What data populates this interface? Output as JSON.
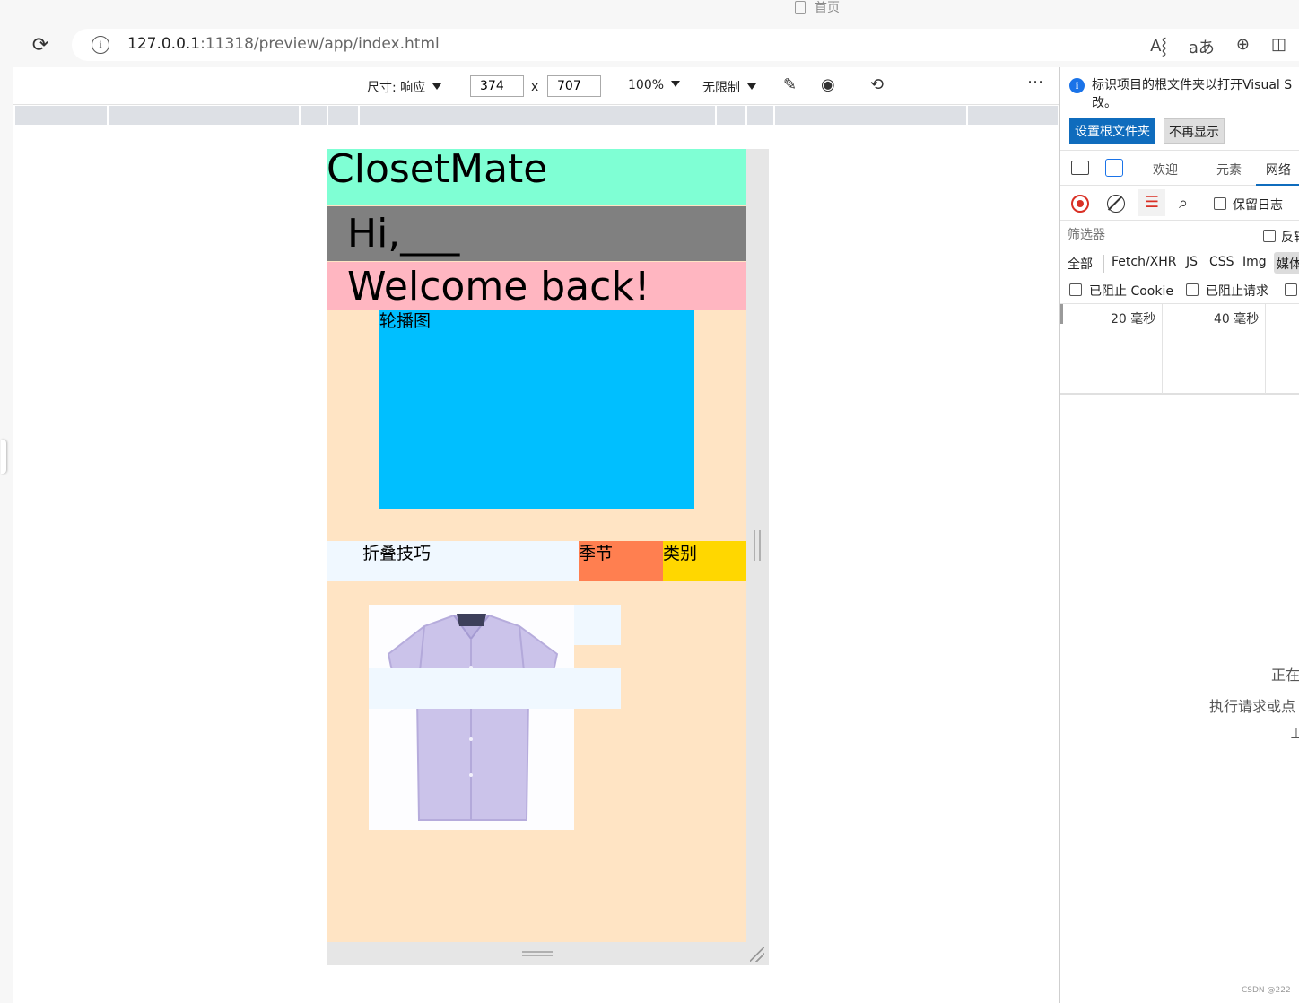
{
  "browser": {
    "tab_title": "首页",
    "url_host": "127.0.0.1",
    "url_rest": ":11318/preview/app/index.html",
    "icons": [
      "reload-icon",
      "info-icon",
      "read-aloud-icon",
      "translate-icon",
      "zoom-icon",
      "split-screen-icon"
    ],
    "read_aloud_glyph": "A⸾",
    "translate_glyph": "aあ"
  },
  "device_toolbar": {
    "size_label": "尺寸: 响应",
    "width": "374",
    "times": "x",
    "height": "707",
    "zoom": "100%",
    "throttle": "无限制",
    "more": "⋯"
  },
  "app": {
    "title": "ClosetMate",
    "greeting": "Hi,___",
    "welcome": "Welcome back!",
    "carousel_label": "轮播图",
    "tabs": [
      {
        "label": "折叠技巧"
      },
      {
        "label": "季节"
      },
      {
        "label": "类别"
      }
    ],
    "colors": {
      "header": "#7fffd4",
      "greeting": "#808080",
      "welcome": "#ffb6c1",
      "background": "#ffe4c4",
      "carousel": "#00bfff",
      "tab_fold": "#f0f8ff",
      "tab_season": "#ff7f50",
      "tab_category": "#ffd700"
    }
  },
  "devtools": {
    "notice": "标识项目的根文件夹以打开Visual S改。",
    "set_root_button": "设置根文件夹",
    "dont_show_button": "不再显示",
    "tabs": [
      "欢迎",
      "元素",
      "网络"
    ],
    "preserve_log": "保留日志",
    "filter_placeholder": "筛选器",
    "invert": "反转",
    "types": [
      "全部",
      "Fetch/XHR",
      "JS",
      "CSS",
      "Img",
      "媒体"
    ],
    "blocked_cookies": "已阻止 Cookie",
    "blocked_requests": "已阻止请求",
    "timeline_labels": [
      "20 毫秒",
      "40 毫秒"
    ],
    "empty_line1": "正在",
    "empty_line2": "执行请求或点",
    "empty_line3": "⊥"
  },
  "watermark": "CSDN @222"
}
